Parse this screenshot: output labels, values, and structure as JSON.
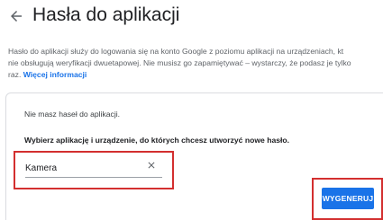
{
  "header": {
    "title": "Hasła do aplikacji",
    "back_icon": "arrow-left-icon"
  },
  "description": {
    "line1": "Hasło do aplikacji służy do logowania się na konto Google z poziomu aplikacji na urządzeniach, kt",
    "line2": "nie obsługują weryfikacji dwuetapowej. Nie musisz go zapamiętywać – wystarczy, że podasz je tylko",
    "line3_prefix": "raz.",
    "more_link": "Więcej informacji"
  },
  "card": {
    "no_passwords": "Nie masz haseł do aplikacji.",
    "select_label": "Wybierz aplikację i urządzenie, do których chcesz utworzyć nowe hasło.",
    "app_input_value": "Kamera",
    "clear_icon": "close-icon",
    "generate_label": "WYGENERUJ"
  },
  "colors": {
    "accent": "#1a73e8",
    "highlight": "#d32f2f"
  }
}
